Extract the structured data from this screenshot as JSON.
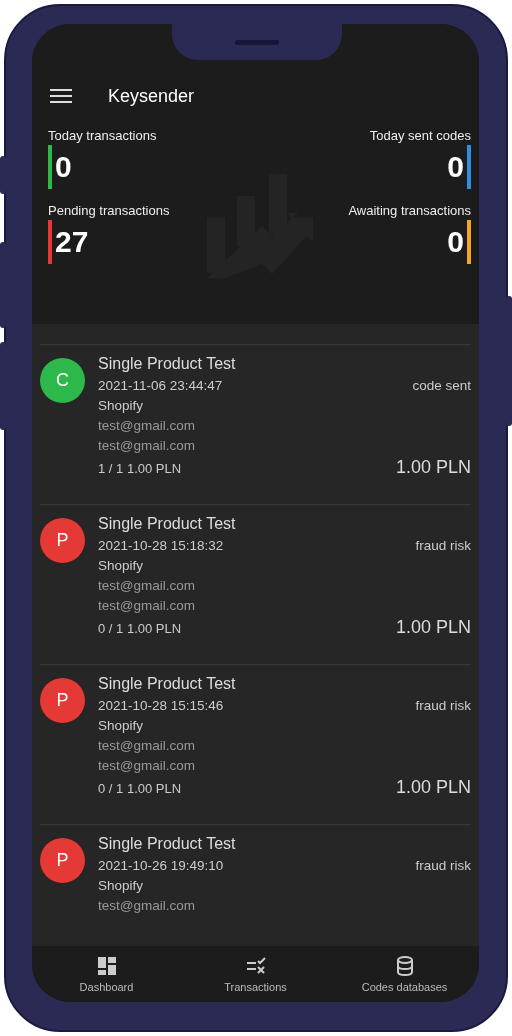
{
  "app_bar": {
    "title": "Keysender"
  },
  "stats": [
    {
      "label": "Today transactions",
      "value": "0",
      "color": "#2db84b"
    },
    {
      "label": "Today sent codes",
      "value": "0",
      "color": "#2f8fe0"
    },
    {
      "label": "Pending transactions",
      "value": "27",
      "color": "#e53935"
    },
    {
      "label": "Awaiting transactions",
      "value": "0",
      "color": "#f5a623"
    }
  ],
  "transactions": [
    {
      "initial": "C",
      "color": "#2db84b",
      "product": "Single Product Test",
      "date": "2021-11-06 23:44:47",
      "status": "code sent",
      "store": "Shopify",
      "emails": [
        "test@gmail.com",
        "test@gmail.com"
      ],
      "quantity": "1 / 1  1.00 PLN",
      "amount": "1.00 PLN"
    },
    {
      "initial": "P",
      "color": "#e53935",
      "product": "Single Product Test",
      "date": "2021-10-28 15:18:32",
      "status": "fraud risk",
      "store": "Shopify",
      "emails": [
        "test@gmail.com",
        "test@gmail.com"
      ],
      "quantity": "0 / 1  1.00 PLN",
      "amount": "1.00 PLN"
    },
    {
      "initial": "P",
      "color": "#e53935",
      "product": "Single Product Test",
      "date": "2021-10-28 15:15:46",
      "status": "fraud risk",
      "store": "Shopify",
      "emails": [
        "test@gmail.com",
        "test@gmail.com"
      ],
      "quantity": "0 / 1  1.00 PLN",
      "amount": "1.00 PLN"
    },
    {
      "initial": "P",
      "color": "#e53935",
      "product": "Single Product Test",
      "date": "2021-10-26 19:49:10",
      "status": "fraud risk",
      "store": "Shopify",
      "emails": [
        "test@gmail.com"
      ]
    }
  ],
  "bottom_nav": [
    {
      "label": "Dashboard",
      "kind": "dashboard"
    },
    {
      "label": "Transactions",
      "kind": "checklist"
    },
    {
      "label": "Codes databases",
      "kind": "database"
    }
  ]
}
